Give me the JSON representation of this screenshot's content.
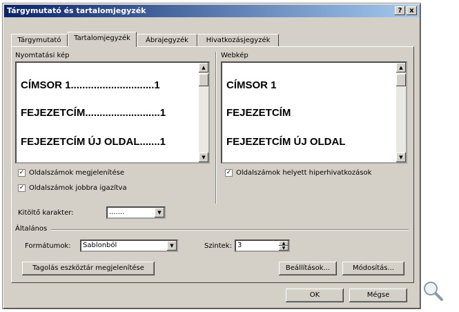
{
  "window": {
    "title": "Tárgymutató és tartalomjegyzék",
    "help": "?",
    "close": "x"
  },
  "tabs": [
    {
      "label": "Tárgymutató"
    },
    {
      "label": "Tartalomjegyzék"
    },
    {
      "label": "Ábrajegyzék"
    },
    {
      "label": "Hivatkozásjegyzék"
    }
  ],
  "print_preview": {
    "label": "Nyomtatási kép",
    "lines": [
      {
        "text": "CÍMSOR 1.............................1"
      },
      {
        "text": "FEJEZETCÍM..........................1"
      },
      {
        "text": "FEJEZETCÍM ÚJ OLDAL.......1"
      }
    ]
  },
  "web_preview": {
    "label": "Webkép",
    "lines": [
      {
        "text": "CÍMSOR 1"
      },
      {
        "text": "FEJEZETCÍM"
      },
      {
        "text": "FEJEZETCÍM ÚJ OLDAL"
      }
    ]
  },
  "options": {
    "show_page_numbers": "Oldalszámok megjelenítése",
    "right_align": "Oldalszámok jobbra igazítva",
    "hyperlinks": "Oldalszámok helyett hiperhivatkozások",
    "tab_leader_label": "Kitöltő karakter:",
    "tab_leader_value": "......."
  },
  "general": {
    "label": "Általános",
    "formats_label": "Formátumok:",
    "formats_value": "Sablonból",
    "levels_label": "Szintek:",
    "levels_value": "3"
  },
  "buttons": {
    "outline_toolbar": "Tagolás eszköztár megjelenítése",
    "options": "Beállítások...",
    "modify": "Módosítás...",
    "ok": "OK",
    "cancel": "Mégse"
  }
}
